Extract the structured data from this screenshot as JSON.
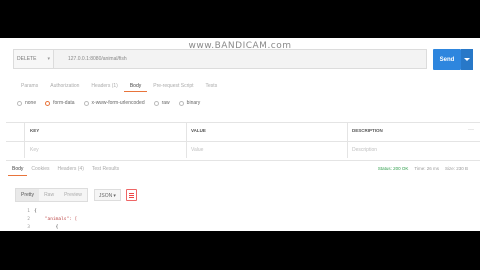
{
  "watermark": "www.BANDICAM.com",
  "request": {
    "method": "DELETE",
    "url": "127.0.0.1:8080/animal/fish",
    "send_label": "Send"
  },
  "request_tabs": [
    "Params",
    "Authorization",
    "Headers (1)",
    "Body",
    "Pre-request Script",
    "Tests"
  ],
  "request_tab_active": 3,
  "body_types": [
    {
      "label": "none",
      "checked": false
    },
    {
      "label": "form-data",
      "checked": true
    },
    {
      "label": "x-www-form-urlencoded",
      "checked": false
    },
    {
      "label": "raw",
      "checked": false
    },
    {
      "label": "binary",
      "checked": false
    }
  ],
  "kv_table": {
    "headers": [
      "KEY",
      "VALUE",
      "DESCRIPTION"
    ],
    "placeholders": [
      "Key",
      "Value",
      "Description"
    ],
    "menu_icon": "more-icon"
  },
  "response_tabs": [
    "Body",
    "Cookies",
    "Headers (4)",
    "Test Results"
  ],
  "response_tab_active": 0,
  "response_status": {
    "status": "Status: 200 OK",
    "time": "Time: 26 ms",
    "size": "Size: 230 B"
  },
  "view_modes": [
    "Pretty",
    "Raw",
    "Preview"
  ],
  "view_mode_active": 0,
  "format": "JSON",
  "code_lines": [
    {
      "n": "1",
      "text": "{"
    },
    {
      "n": "2",
      "text": "    \"animals\": ["
    },
    {
      "n": "3",
      "text": "        {"
    }
  ],
  "colors": {
    "accent": "#e8743b",
    "send": "#2e86de",
    "ok": "#2e9d4a"
  }
}
